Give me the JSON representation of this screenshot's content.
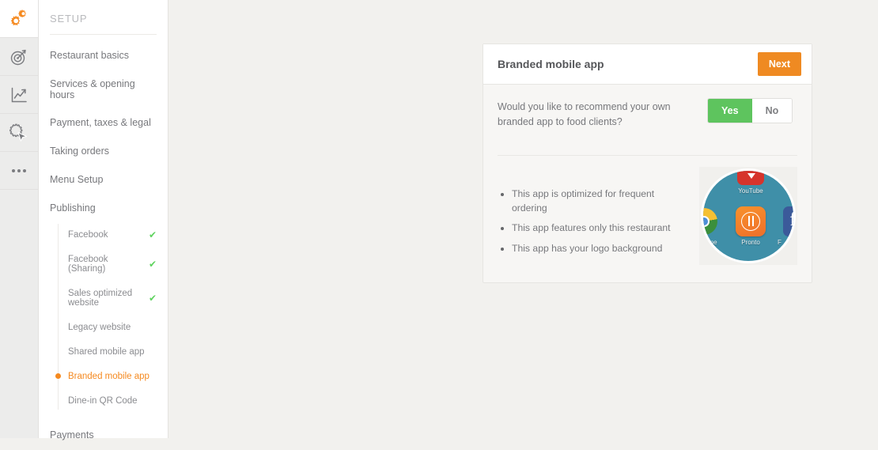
{
  "rail": {
    "items": [
      {
        "icon": "gears-icon",
        "name": "rail-item-setup",
        "active": true
      },
      {
        "icon": "target-icon",
        "name": "rail-item-marketing",
        "active": false
      },
      {
        "icon": "chart-line-icon",
        "name": "rail-item-reports",
        "active": false
      },
      {
        "icon": "gear-cursor-icon",
        "name": "rail-item-operations",
        "active": false
      },
      {
        "icon": "ellipsis-icon",
        "name": "rail-item-more",
        "active": false
      }
    ]
  },
  "sidebar": {
    "title": "SETUP",
    "items": [
      {
        "label": "Restaurant basics"
      },
      {
        "label": "Services & opening hours"
      },
      {
        "label": "Payment, taxes & legal"
      },
      {
        "label": "Taking orders"
      },
      {
        "label": "Menu Setup"
      },
      {
        "label": "Publishing"
      }
    ],
    "sub_items": [
      {
        "label": "Facebook",
        "done": true,
        "active": false
      },
      {
        "label": "Facebook (Sharing)",
        "done": true,
        "active": false
      },
      {
        "label": "Sales optimized website",
        "done": true,
        "active": false
      },
      {
        "label": "Legacy website",
        "done": false,
        "active": false
      },
      {
        "label": "Shared mobile app",
        "done": false,
        "active": false
      },
      {
        "label": "Branded mobile app",
        "done": false,
        "active": true
      },
      {
        "label": "Dine-in QR Code",
        "done": false,
        "active": false
      }
    ],
    "footer_item": {
      "label": "Payments"
    },
    "check_glyph": "✔",
    "accent_color": "#f5891f",
    "check_color": "#5fd35f"
  },
  "card": {
    "title": "Branded mobile app",
    "next_label": "Next",
    "next_color": "#ef8a22",
    "question": "Would you like to recommend your own branded app to food clients?",
    "toggle": {
      "yes_label": "Yes",
      "no_label": "No",
      "selected": "Yes",
      "on_color": "#5ec45e"
    },
    "features": [
      "This app is optimized for frequent ordering",
      "This app features only this restaurant",
      "This app has your logo background"
    ],
    "preview": {
      "background_color": "#3f8fa8",
      "tiles": [
        {
          "name": "youtube-app-icon",
          "label": "YouTube",
          "color": "#d6342c"
        },
        {
          "name": "chrome-app-icon",
          "label": "me",
          "color": "#dd4b3e"
        },
        {
          "name": "pronto-app-icon",
          "label": "Pronto",
          "color": "#f8922c"
        },
        {
          "name": "facebook-app-icon",
          "label": "F",
          "color": "#3b5a9a"
        }
      ]
    }
  }
}
